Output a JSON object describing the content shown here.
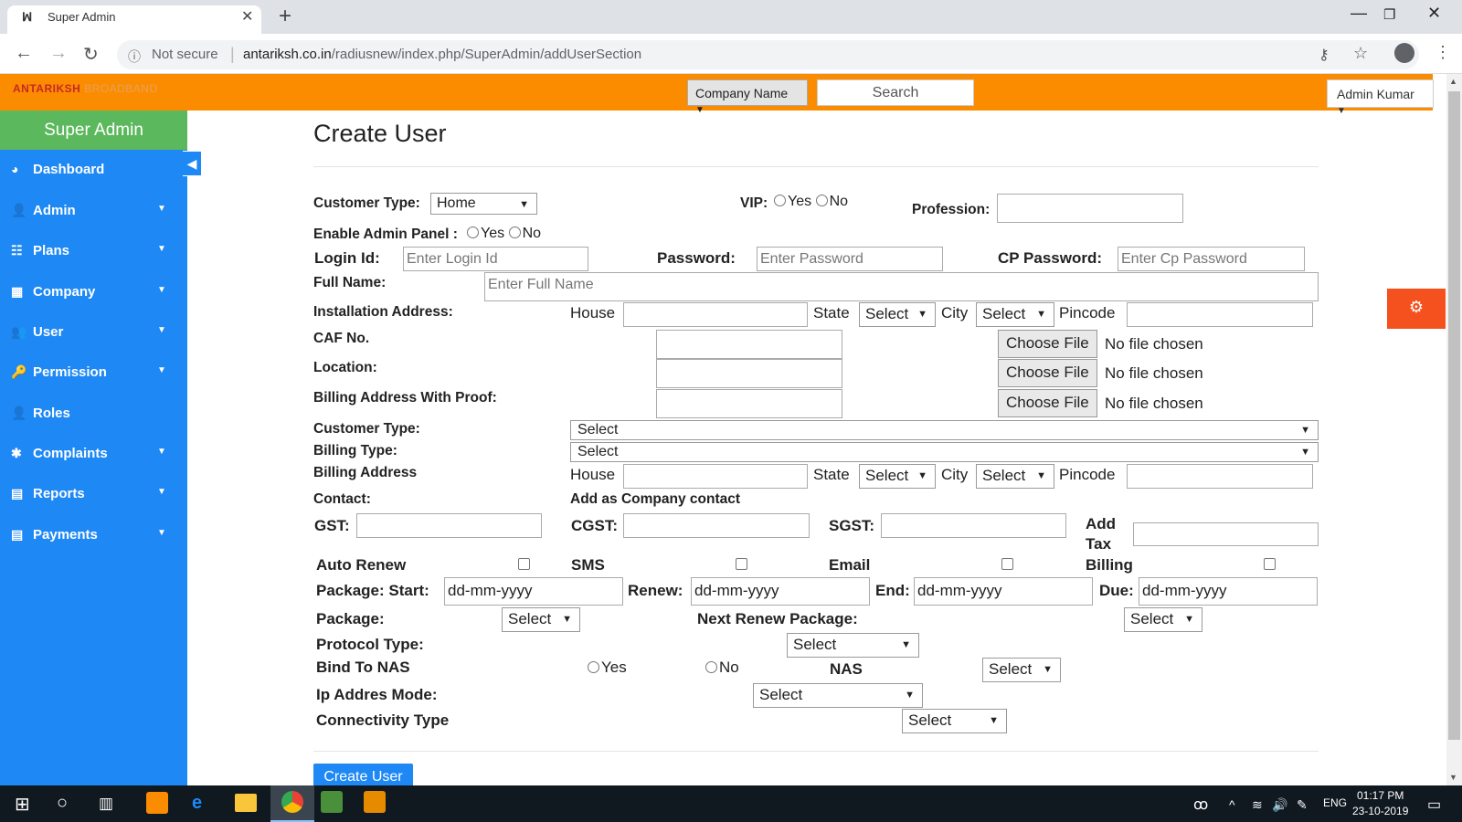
{
  "browser": {
    "tab_title": "Super Admin",
    "tab_icon": "ꟽ",
    "new_tab": "+",
    "not_secure": "Not secure",
    "url_domain": "antariksh.co.in",
    "url_path": "/radiusnew/index.php/SuperAdmin/addUserSection"
  },
  "header": {
    "logo_main": "ANTARIKSH",
    "logo_sub": "BROADBAND",
    "company_dropdown": "Company Name",
    "search_placeholder": "Search",
    "user_dropdown": "Admin Kumar"
  },
  "sidebar": {
    "title": "Super Admin",
    "items": [
      {
        "label": "Dashboard",
        "icon": "dashboard-icon",
        "has_caret": false
      },
      {
        "label": "Admin",
        "icon": "user-admin-icon",
        "has_caret": true
      },
      {
        "label": "Plans",
        "icon": "sitemap-icon",
        "has_caret": true
      },
      {
        "label": "Company",
        "icon": "building-icon",
        "has_caret": true
      },
      {
        "label": "User",
        "icon": "users-icon",
        "has_caret": true
      },
      {
        "label": "Permission",
        "icon": "key-icon",
        "has_caret": true
      },
      {
        "label": "Roles",
        "icon": "user-icon",
        "has_caret": false
      },
      {
        "label": "Complaints",
        "icon": "bug-icon",
        "has_caret": true
      },
      {
        "label": "Reports",
        "icon": "file-icon",
        "has_caret": true
      },
      {
        "label": "Payments",
        "icon": "file-icon",
        "has_caret": true
      }
    ]
  },
  "form": {
    "title": "Create User",
    "customer_type_label": "Customer Type:",
    "customer_type_value": "Home",
    "vip_label": "VIP:",
    "yes": "Yes",
    "no": "No",
    "profession_label": "Profession:",
    "enable_admin_label": "Enable Admin Panel :",
    "login_id_label": "Login Id:",
    "login_id_placeholder": "Enter Login Id",
    "password_label": "Password:",
    "password_placeholder": "Enter Password",
    "cp_password_label": "CP Password:",
    "cp_password_placeholder": "Enter Cp Password",
    "full_name_label": "Full Name:",
    "full_name_placeholder": "Enter Full Name",
    "installation_address_label": "Installation Address:",
    "house": "House",
    "state": "State",
    "city": "City",
    "pincode": "Pincode",
    "select": "Select",
    "caf_label": "CAF No.",
    "location_label": "Location:",
    "billing_proof_label": "Billing Address With Proof:",
    "choose_file": "Choose File",
    "no_file": "No file chosen",
    "customer_type2_label": "Customer Type:",
    "billing_type_label": "Billing Type:",
    "billing_address_label": "Billing Address",
    "contact_label": "Contact:",
    "add_company_contact": "Add as Company contact",
    "gst_label": "GST:",
    "cgst_label": "CGST:",
    "sgst_label": "SGST:",
    "add_tax_label_1": "Add",
    "add_tax_label_2": "Tax",
    "auto_renew_label": "Auto Renew",
    "sms_label": "SMS",
    "email_label": "Email",
    "billing_label": "Billing",
    "package_start_label": "Package: Start:",
    "renew_label": "Renew:",
    "end_label": "End:",
    "due_label": "Due:",
    "date_placeholder": "dd-mm-yyyy",
    "package_label": "Package:",
    "next_renew_label": "Next Renew Package:",
    "protocol_label": "Protocol Type:",
    "bind_nas_label": "Bind To NAS",
    "nas_label": "NAS",
    "ip_mode_label": "Ip Addres Mode:",
    "connectivity_label": "Connectivity Type",
    "submit": "Create User"
  },
  "taskbar": {
    "time": "01:17 PM",
    "date": "23-10-2019",
    "lang": "ENG"
  },
  "colors": {
    "header_orange": "#fb8c00",
    "sidebar_blue": "#1e88f5",
    "sidebar_head_green": "#5cb85c",
    "gear_red": "#f4511e"
  }
}
